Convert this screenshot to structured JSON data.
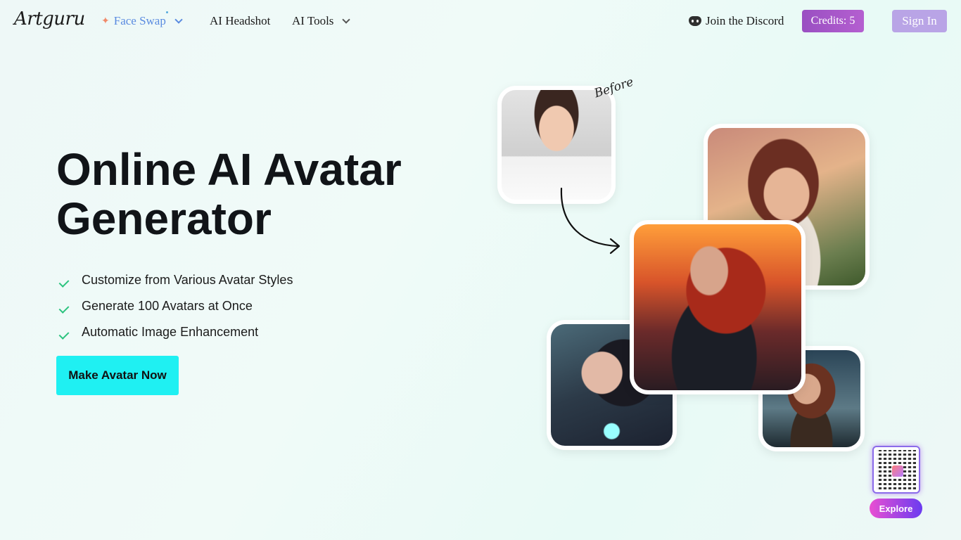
{
  "brand": {
    "logo_text": "Artguru"
  },
  "nav": {
    "face_swap": "Face Swap",
    "ai_headshot": "AI Headshot",
    "ai_tools": "AI Tools",
    "discord": "Join the Discord",
    "credits": "Credits: 5",
    "sign_in": "Sign In"
  },
  "hero": {
    "title_line1": "Online AI Avatar",
    "title_line2": "Generator",
    "features": [
      "Customize from Various Avatar Styles",
      "Generate 100 Avatars at Once",
      "Automatic Image Enhancement"
    ],
    "cta": "Make Avatar Now"
  },
  "showcase": {
    "before_label": "Before"
  },
  "widget": {
    "explore_label": "Explore"
  },
  "colors": {
    "cta": "#1ff0f2",
    "credits": "#a353c9",
    "sign_in": "#b9a4e6",
    "check": "#2bc37e"
  }
}
